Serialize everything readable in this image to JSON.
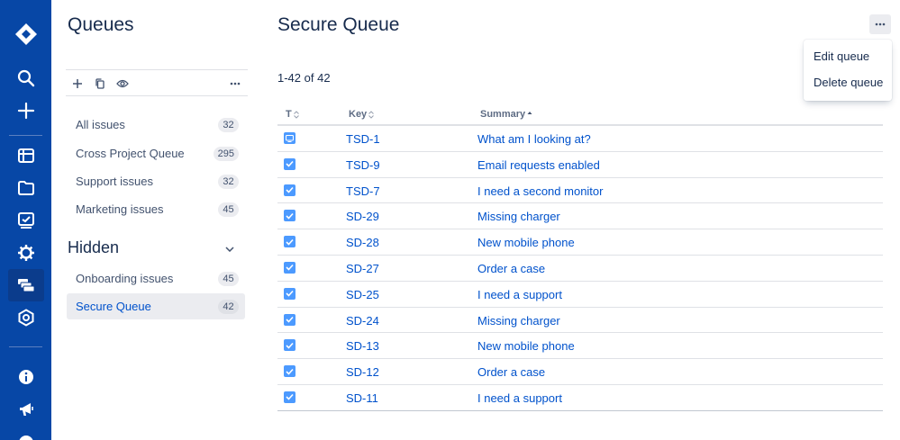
{
  "global_nav": {
    "logo_icon": "jira-logo-icon",
    "items": [
      {
        "icon": "search-icon"
      },
      {
        "icon": "create-plus-icon"
      },
      {
        "icon": "board-icon"
      },
      {
        "icon": "projects-folder-icon"
      },
      {
        "icon": "reports-icon"
      },
      {
        "icon": "settings-gear-icon"
      },
      {
        "icon": "queues-icon",
        "active": true
      },
      {
        "icon": "hexagon-icon"
      },
      {
        "icon": "info-icon"
      },
      {
        "icon": "megaphone-icon"
      }
    ],
    "colors": {
      "background": "#0747a6",
      "active": "#0b3c8c"
    }
  },
  "sidebar": {
    "title": "Queues",
    "toolbar": {
      "icons": [
        "add-icon",
        "copy-icon",
        "watch-eye-icon",
        "more-icon"
      ]
    },
    "queues": [
      {
        "label": "All issues",
        "count": "32"
      },
      {
        "label": "Cross Project Queue",
        "count": "295"
      },
      {
        "label": "Support issues",
        "count": "32"
      },
      {
        "label": "Marketing issues",
        "count": "45"
      }
    ],
    "hidden_section": {
      "title": "Hidden",
      "queues": [
        {
          "label": "Onboarding issues",
          "count": "45"
        },
        {
          "label": "Secure Queue",
          "count": "42",
          "active": true
        }
      ]
    }
  },
  "main": {
    "title": "Secure Queue",
    "result_count": "1-42 of 42",
    "more_menu": {
      "items": [
        "Edit queue",
        "Delete queue"
      ]
    },
    "table": {
      "columns": [
        "T",
        "Key",
        "Summary"
      ],
      "rows": [
        {
          "type": "service-request-icon",
          "key": "TSD-1",
          "summary": "What am I looking at?"
        },
        {
          "type": "task-checkbox-icon",
          "key": "TSD-9",
          "summary": "Email requests enabled"
        },
        {
          "type": "task-checkbox-icon",
          "key": "TSD-7",
          "summary": "I need a second monitor"
        },
        {
          "type": "task-checkbox-icon",
          "key": "SD-29",
          "summary": "Missing charger"
        },
        {
          "type": "task-checkbox-icon",
          "key": "SD-28",
          "summary": "New mobile phone"
        },
        {
          "type": "task-checkbox-icon",
          "key": "SD-27",
          "summary": "Order a case"
        },
        {
          "type": "task-checkbox-icon",
          "key": "SD-25",
          "summary": "I need a support"
        },
        {
          "type": "task-checkbox-icon",
          "key": "SD-24",
          "summary": "Missing charger"
        },
        {
          "type": "task-checkbox-icon",
          "key": "SD-13",
          "summary": "New mobile phone"
        },
        {
          "type": "task-checkbox-icon",
          "key": "SD-12",
          "summary": "Order a case"
        },
        {
          "type": "task-checkbox-icon",
          "key": "SD-11",
          "summary": "I need a support"
        }
      ]
    }
  },
  "colors": {
    "link": "#0052cc",
    "text": "#172b4d",
    "muted": "#5e6c84",
    "task_icon": "#4c9aff"
  }
}
